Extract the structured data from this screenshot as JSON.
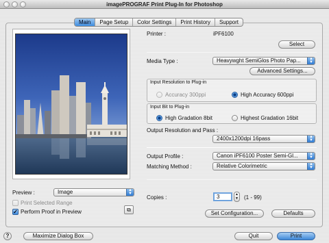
{
  "window": {
    "title": "imagePROGRAF Print Plug-In for Photoshop"
  },
  "tabs": [
    "Main",
    "Page Setup",
    "Color Settings",
    "Print History",
    "Support"
  ],
  "active_tab": "Main",
  "printer": {
    "label": "Printer :",
    "value": "iPF6100",
    "select_label": "Select"
  },
  "media_type": {
    "label": "Media Type :",
    "value": "Heavywght SemiGlos Photo Pap...",
    "advanced_label": "Advanced Settings..."
  },
  "input_resolution": {
    "title": "Input Resolution to Plug-in",
    "options": [
      "Accuracy 300ppi",
      "High Accuracy 600ppi"
    ],
    "selected": "High Accuracy 600ppi"
  },
  "input_bit": {
    "title": "Input Bit to Plug-in",
    "options": [
      "High Gradation 8bit",
      "Highest Gradation 16bit"
    ],
    "selected": "High Gradation 8bit"
  },
  "output_resolution": {
    "label": "Output Resolution and Pass :",
    "value": "2400x1200dpi 16pass"
  },
  "output_profile": {
    "label": "Output Profile :",
    "value": "Canon iPF6100 Poster Semi-Gl..."
  },
  "matching_method": {
    "label": "Matching Method :",
    "value": "Relative Colorimetric"
  },
  "copies": {
    "label": "Copies :",
    "value": "3",
    "range": "(1 - 99)"
  },
  "preview": {
    "label": "Preview :",
    "value": "Image",
    "print_selected_range": "Print Selected Range",
    "perform_proof": "Perform Proof in Preview",
    "perform_proof_checked": true
  },
  "buttons": {
    "set_configuration": "Set Configuration...",
    "defaults": "Defaults",
    "maximize": "Maximize Dialog Box",
    "quit": "Quit",
    "print": "Print"
  },
  "help_glyph": "?"
}
